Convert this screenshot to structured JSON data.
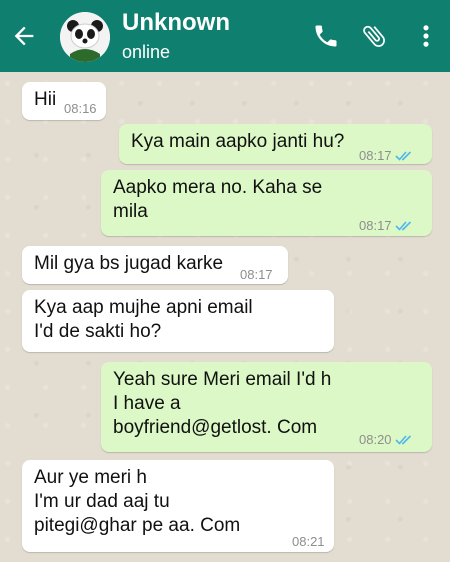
{
  "header": {
    "contact_name": "Unknown",
    "status": "online",
    "colors": {
      "bar": "#0f7f6f",
      "text": "#ffffff"
    },
    "icons": [
      "back-arrow-icon",
      "avatar",
      "call-icon",
      "paperclip-icon",
      "more-vert-icon"
    ]
  },
  "messages": [
    {
      "direction": "incoming",
      "text": "Hii",
      "time": "08:16"
    },
    {
      "direction": "outgoing",
      "text": "Kya main aapko janti hu?",
      "time": "08:17",
      "ticks": "read"
    },
    {
      "direction": "outgoing",
      "text": "Aapko mera no. Kaha se\nmila",
      "time": "08:17",
      "ticks": "read"
    },
    {
      "direction": "incoming",
      "text": "Mil gya bs jugad karke",
      "time": "08:17"
    },
    {
      "direction": "incoming",
      "text": "Kya aap mujhe apni email\nI'd de sakti ho?",
      "time": ""
    },
    {
      "direction": "outgoing",
      "text": "Yeah sure Meri email I'd h\nI have a\nboyfriend@getlost. Com",
      "time": "08:20",
      "ticks": "read"
    },
    {
      "direction": "incoming",
      "text": "Aur ye meri h\nI'm ur dad aaj tu\npitegi@ghar pe aa. Com",
      "time": "08:21"
    }
  ],
  "colors": {
    "incoming": "#ffffff",
    "outgoing": "#dcf8c6",
    "read_ticks": "#4fb6ec"
  }
}
